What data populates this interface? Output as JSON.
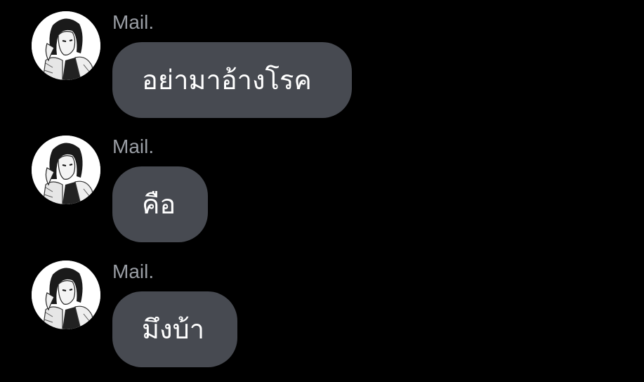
{
  "messages": [
    {
      "sender": "Mail.",
      "text": "อย่ามาอ้างโรค",
      "avatar_icon": "manga-portrait-avatar"
    },
    {
      "sender": "Mail.",
      "text": "คือ",
      "avatar_icon": "manga-portrait-avatar"
    },
    {
      "sender": "Mail.",
      "text": "มึงบ้า",
      "avatar_icon": "manga-portrait-avatar"
    }
  ],
  "colors": {
    "background": "#000000",
    "bubble": "#474a51",
    "sender_name": "#9a9ea5",
    "message_text": "#ffffff"
  }
}
